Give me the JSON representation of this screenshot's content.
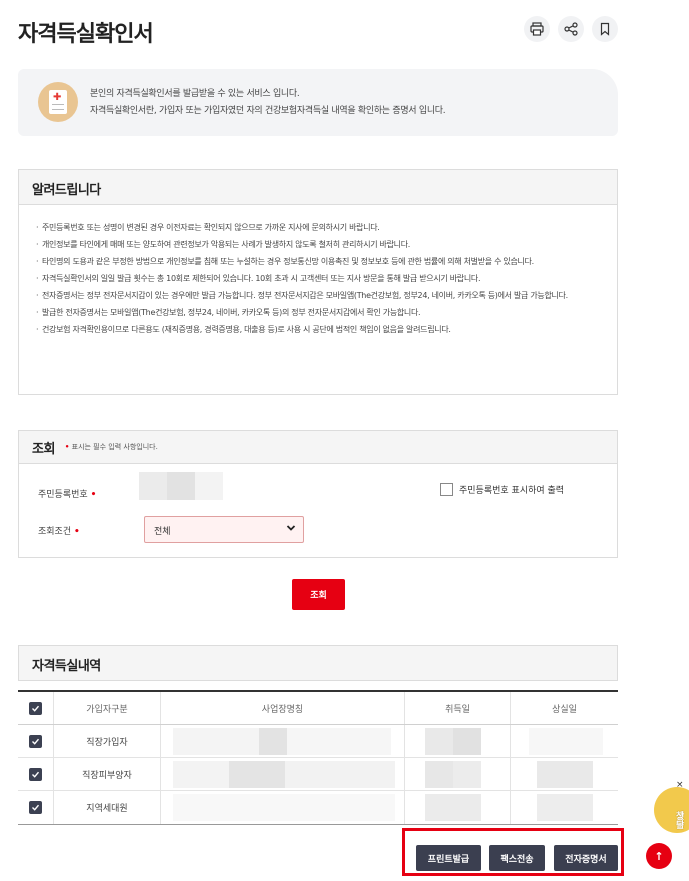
{
  "page": {
    "title": "자격득실확인서"
  },
  "top_actions": [
    {
      "name": "print-icon",
      "glyph": "🖶"
    },
    {
      "name": "share-icon",
      "glyph": "⋖"
    },
    {
      "name": "bookmark-icon",
      "glyph": "▯"
    }
  ],
  "intro": {
    "line1": "본인의 자격득실확인서를 발급받을 수 있는 서비스 입니다.",
    "line2": "자격득실확인서란, 가입자 또는 가입자였던 자의 건강보험자격득실 내역을 확인하는 증명서 입니다."
  },
  "notice": {
    "title": "알려드립니다",
    "items": [
      "주민등록번호 또는 성명이 변경된 경우 이전자료는 확인되지 않으므로 가까운 지사에 문의하시기 바랍니다.",
      "개인정보를 타인에게 매매 또는 양도하여 관련정보가 악용되는 사례가 발생하지 않도록 철저히 관리하시기 바랍니다.",
      "타인명의 도용과 같은 부정한 방법으로 개인정보를 침해 또는 누설하는 경우 정보통신망 이용촉진 및 정보보호 등에 관한 법률에 의해 처벌받을 수 있습니다.",
      "자격득실확인서의 일일 발급 횟수는 총 10회로 제한되어 있습니다. 10회 초과 시 고객센터 또는 지사 방문을 통해 발급 받으시기 바랍니다.",
      "전자증명서는 정부 전자문서지갑이 있는 경우에만 발급 가능합니다. 정부 전자문서지갑은 모바일앱(The건강보험, 정부24, 네이버, 카카오톡 등)에서 발급 가능합니다.",
      "발급한 전자증명서는 모바일앱(The건강보험, 정부24, 네이버, 카카오톡 등)의 정부 전자문서지갑에서 확인 가능합니다.",
      "건강보험 자격확인용이므로 다른용도 (재직증명용, 경력증명용, 대출용 등)로 사용 시 공단에 법적인 책임이 없음을 알려드립니다."
    ]
  },
  "search": {
    "title": "조회",
    "required_note": "표시는 필수 입력 사항입니다.",
    "rrn_label": "주민등록번호",
    "rrn_display_label": "주민등록번호 표시하여 출력",
    "condition_label": "조회조건",
    "condition_value": "전체",
    "submit_label": "조회"
  },
  "history": {
    "title": "자격득실내역",
    "columns": [
      "가입자구분",
      "사업장명칭",
      "취득일",
      "상실일"
    ],
    "rows": [
      {
        "type": "직장가입자"
      },
      {
        "type": "직장피부양자"
      },
      {
        "type": "지역세대원"
      }
    ]
  },
  "actions": {
    "print_label": "프린트발급",
    "fax_label": "팩스전송",
    "ecert_label": "전자증명서"
  },
  "chatbot": {
    "label_top": "챗봇",
    "label_bottom": "상담",
    "close": "×"
  },
  "scroll_top": "↑",
  "colors": {
    "accent_red": "#e60012",
    "dark_button": "#3b3f50",
    "chatbot_yellow": "#f2c94c"
  }
}
